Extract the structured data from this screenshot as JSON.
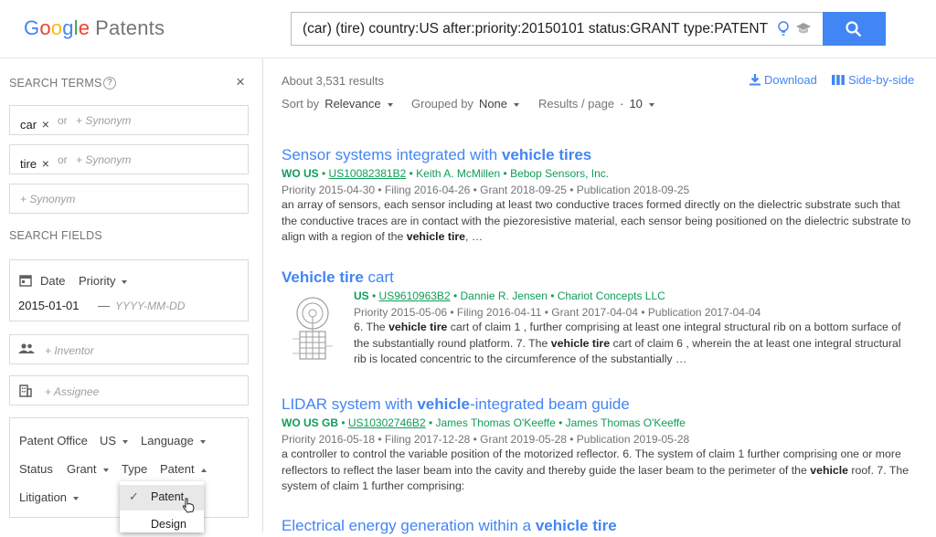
{
  "header": {
    "logo_google": [
      "G",
      "o",
      "o",
      "g",
      "l",
      "e"
    ],
    "logo_product": "Patents",
    "search_query": "(car) (tire) country:US after:priority:20150101 status:GRANT type:PATENT"
  },
  "sidebar": {
    "search_terms_label": "SEARCH TERMS",
    "help_glyph": "?",
    "close_glyph": "×",
    "terms": [
      {
        "value": "car",
        "remove": "×",
        "or": "or",
        "synonym_placeholder": "+ Synonym"
      },
      {
        "value": "tire",
        "remove": "×",
        "or": "or",
        "synonym_placeholder": "+ Synonym"
      }
    ],
    "empty_synonym_placeholder": "+ Synonym",
    "search_fields_label": "SEARCH FIELDS",
    "date": {
      "label": "Date",
      "type": "Priority",
      "from": "2015-01-01",
      "dash": "—",
      "to_placeholder": "YYYY-MM-DD"
    },
    "inventor_placeholder": "+ Inventor",
    "assignee_placeholder": "+ Assignee",
    "filters": {
      "patent_office_label": "Patent Office",
      "patent_office_value": "US",
      "language_label": "Language",
      "status_label": "Status",
      "status_value": "Grant",
      "type_label": "Type",
      "type_value": "Patent",
      "litigation_label": "Litigation"
    },
    "type_menu": {
      "check_glyph": "✓",
      "options": [
        "Patent",
        "Design"
      ]
    }
  },
  "main": {
    "results_count": "About 3,531 results",
    "download_label": "Download",
    "side_by_side_label": "Side-by-side",
    "sort_label": "Sort by",
    "sort_value": "Relevance",
    "grouped_label": "Grouped by",
    "grouped_value": "None",
    "per_page_label": "Results / page",
    "per_page_value": "10",
    "sep": "·",
    "results": [
      {
        "title_parts": [
          "Sensor systems integrated with ",
          "vehicle tires"
        ],
        "countries": "WO US",
        "number": "US10082381B2",
        "people": "Keith A. McMillen • Bebop Sensors, Inc.",
        "dates": "Priority 2015-04-30 • Filing 2016-04-26 • Grant 2018-09-25 • Publication 2018-09-25",
        "snippet_parts": [
          "an array of sensors, each sensor including at least two conductive traces formed directly on the dielectric substrate such that the conductive traces are in contact with the piezoresistive material, each sensor being positioned on the dielectric substrate to align with a region of the ",
          "vehicle tire",
          ", …"
        ]
      },
      {
        "title_parts": [
          "Vehicle tire",
          " cart"
        ],
        "countries": "US",
        "number": "US9610963B2",
        "people": "Dannie R. Jensen • Chariot Concepts LLC",
        "dates": "Priority 2015-05-06 • Filing 2016-04-11 • Grant 2017-04-04 • Publication 2017-04-04",
        "snippet_parts": [
          "6. The ",
          "vehicle tire",
          " cart of claim 1 , further comprising at least one integral structural rib on a bottom surface of the substantially round platform. 7. The ",
          "vehicle tire",
          " cart of claim 6 , wherein the at least one integral structural rib is located concentric to the circumference of the substantially …"
        ]
      },
      {
        "title_parts": [
          "LIDAR system with ",
          "vehicle",
          "-integrated beam guide"
        ],
        "countries": "WO US GB",
        "number": "US10302746B2",
        "people": "James Thomas O'Keeffe • James Thomas O'Keeffe",
        "dates": "Priority 2016-05-18 • Filing 2017-12-28 • Grant 2019-05-28 • Publication 2019-05-28",
        "snippet_parts": [
          "a controller to control the variable position of the motorized reflector. 6. The system of claim 1 further comprising one or more reflectors to reflect the laser beam into the cavity and thereby guide the laser beam to the perimeter of the ",
          "vehicle",
          " roof. 7. The system of claim 1 further comprising:"
        ]
      },
      {
        "title_parts": [
          "Electrical energy generation within a ",
          "vehicle tire"
        ]
      }
    ]
  },
  "colors": {
    "accent": "#4285f4",
    "id_green": "#0f9d58",
    "muted": "#757575"
  }
}
